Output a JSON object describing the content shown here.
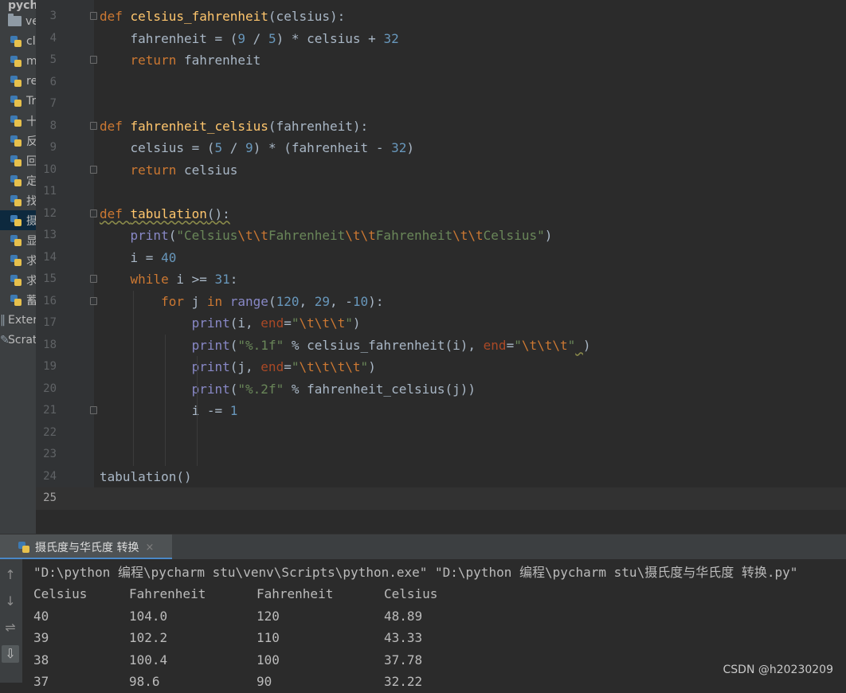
{
  "project_tree": {
    "root_label": "pych",
    "items": [
      {
        "label": "ve",
        "kind": "folder",
        "selected": false
      },
      {
        "label": "cl",
        "kind": "py",
        "selected": false
      },
      {
        "label": "m",
        "kind": "py",
        "selected": false
      },
      {
        "label": "re",
        "kind": "py",
        "selected": false
      },
      {
        "label": "Tr",
        "kind": "py",
        "selected": false
      },
      {
        "label": "十",
        "kind": "py",
        "selected": false
      },
      {
        "label": "反",
        "kind": "py",
        "selected": false
      },
      {
        "label": "回",
        "kind": "py",
        "selected": false
      },
      {
        "label": "定",
        "kind": "py",
        "selected": false
      },
      {
        "label": "找",
        "kind": "py",
        "selected": false
      },
      {
        "label": "摄",
        "kind": "py",
        "selected": true
      },
      {
        "label": "显",
        "kind": "py",
        "selected": false
      },
      {
        "label": "求",
        "kind": "py",
        "selected": false
      },
      {
        "label": "求",
        "kind": "py",
        "selected": false
      },
      {
        "label": "蓄",
        "kind": "py",
        "selected": false
      },
      {
        "label": "Exter",
        "kind": "lib",
        "selected": false
      },
      {
        "label": "Scrat",
        "kind": "scratch",
        "selected": false
      }
    ]
  },
  "editor": {
    "current_line": "25",
    "lines": [
      {
        "no": "3",
        "fold": true,
        "indent": 0,
        "code": [
          [
            "kw",
            "def "
          ],
          [
            "fn",
            "celsius_fahrenheit"
          ],
          [
            "t",
            "(celsius):"
          ]
        ]
      },
      {
        "no": "4",
        "fold": false,
        "indent": 1,
        "code": [
          [
            "t",
            "fahrenheit = ("
          ],
          [
            "num",
            "9"
          ],
          [
            "t",
            " / "
          ],
          [
            "num",
            "5"
          ],
          [
            "t",
            ") * celsius + "
          ],
          [
            "num",
            "32"
          ]
        ]
      },
      {
        "no": "5",
        "fold": true,
        "indent": 1,
        "code": [
          [
            "kw",
            "return "
          ],
          [
            "t",
            "fahrenheit"
          ]
        ]
      },
      {
        "no": "6",
        "fold": false,
        "indent": 0,
        "code": []
      },
      {
        "no": "7",
        "fold": false,
        "indent": 0,
        "code": []
      },
      {
        "no": "8",
        "fold": true,
        "indent": 0,
        "code": [
          [
            "kw",
            "def "
          ],
          [
            "fn",
            "fahrenheit_celsius"
          ],
          [
            "t",
            "(fahrenheit):"
          ]
        ]
      },
      {
        "no": "9",
        "fold": false,
        "indent": 1,
        "code": [
          [
            "t",
            "celsius = ("
          ],
          [
            "num",
            "5"
          ],
          [
            "t",
            " / "
          ],
          [
            "num",
            "9"
          ],
          [
            "t",
            ") * (fahrenheit - "
          ],
          [
            "num",
            "32"
          ],
          [
            "t",
            ")"
          ]
        ]
      },
      {
        "no": "10",
        "fold": true,
        "indent": 1,
        "code": [
          [
            "kw",
            "return "
          ],
          [
            "t",
            "celsius"
          ]
        ]
      },
      {
        "no": "11",
        "fold": false,
        "indent": 0,
        "code": []
      },
      {
        "no": "12",
        "fold": true,
        "indent": 0,
        "code": [
          [
            "kwwavy",
            "def "
          ],
          [
            "fnwavy",
            "tabulation"
          ],
          [
            "twavy",
            "():"
          ]
        ]
      },
      {
        "no": "13",
        "fold": false,
        "indent": 1,
        "code": [
          [
            "bi",
            "print"
          ],
          [
            "t",
            "("
          ],
          [
            "str",
            "\"Celsius"
          ],
          [
            "esc",
            "\\t\\t"
          ],
          [
            "str",
            "Fahrenheit"
          ],
          [
            "esc",
            "\\t\\t"
          ],
          [
            "str",
            "Fahrenheit"
          ],
          [
            "esc",
            "\\t\\t"
          ],
          [
            "str",
            "Celsius\""
          ],
          [
            "t",
            ")"
          ]
        ]
      },
      {
        "no": "14",
        "fold": false,
        "indent": 1,
        "code": [
          [
            "t",
            "i = "
          ],
          [
            "num",
            "40"
          ]
        ]
      },
      {
        "no": "15",
        "fold": true,
        "indent": 1,
        "code": [
          [
            "kw",
            "while "
          ],
          [
            "t",
            "i >= "
          ],
          [
            "num",
            "31"
          ],
          [
            "t",
            ":"
          ]
        ]
      },
      {
        "no": "16",
        "fold": true,
        "indent": 2,
        "code": [
          [
            "kw",
            "for "
          ],
          [
            "t",
            "j "
          ],
          [
            "kw",
            "in "
          ],
          [
            "bi",
            "range"
          ],
          [
            "t",
            "("
          ],
          [
            "num",
            "120"
          ],
          [
            "t",
            ", "
          ],
          [
            "num",
            "29"
          ],
          [
            "t",
            ", -"
          ],
          [
            "num",
            "10"
          ],
          [
            "t",
            "):"
          ]
        ]
      },
      {
        "no": "17",
        "fold": false,
        "indent": 3,
        "code": [
          [
            "bi",
            "print"
          ],
          [
            "t",
            "(i, "
          ],
          [
            "prm",
            "end"
          ],
          [
            "t",
            "="
          ],
          [
            "str",
            "\""
          ],
          [
            "esc",
            "\\t\\t\\t"
          ],
          [
            "str",
            "\""
          ],
          [
            "t",
            ")"
          ]
        ]
      },
      {
        "no": "18",
        "fold": false,
        "indent": 3,
        "code": [
          [
            "bi",
            "print"
          ],
          [
            "t",
            "("
          ],
          [
            "str",
            "\"%.1f\""
          ],
          [
            "t",
            " % celsius_fahrenheit(i), "
          ],
          [
            "prm",
            "end"
          ],
          [
            "t",
            "="
          ],
          [
            "str",
            "\""
          ],
          [
            "esc",
            "\\t\\t\\t"
          ],
          [
            "str",
            "\""
          ],
          [
            "twavy",
            " "
          ],
          [
            "t",
            ")"
          ]
        ]
      },
      {
        "no": "19",
        "fold": false,
        "indent": 3,
        "code": [
          [
            "bi",
            "print"
          ],
          [
            "t",
            "(j, "
          ],
          [
            "prm",
            "end"
          ],
          [
            "t",
            "="
          ],
          [
            "str",
            "\""
          ],
          [
            "esc",
            "\\t\\t\\t\\t"
          ],
          [
            "str",
            "\""
          ],
          [
            "t",
            ")"
          ]
        ]
      },
      {
        "no": "20",
        "fold": false,
        "indent": 3,
        "code": [
          [
            "bi",
            "print"
          ],
          [
            "t",
            "("
          ],
          [
            "str",
            "\"%.2f\""
          ],
          [
            "t",
            " % fahrenheit_celsius(j))"
          ]
        ]
      },
      {
        "no": "21",
        "fold": true,
        "indent": 3,
        "code": [
          [
            "t",
            "i -= "
          ],
          [
            "num",
            "1"
          ]
        ]
      },
      {
        "no": "22",
        "fold": false,
        "indent": 0,
        "code": []
      },
      {
        "no": "23",
        "fold": false,
        "indent": 0,
        "code": []
      },
      {
        "no": "24",
        "fold": false,
        "indent": 0,
        "code": [
          [
            "t",
            "tabulation()"
          ]
        ]
      },
      {
        "no": "25",
        "fold": false,
        "indent": 0,
        "code": []
      }
    ]
  },
  "run_panel": {
    "tab_label": "摄氏度与华氏度 转换",
    "close_glyph": "×",
    "tools": [
      "↑",
      "↓",
      "⇌",
      "⇩"
    ],
    "command": "\"D:\\python 编程\\pycharm stu\\venv\\Scripts\\python.exe\" \"D:\\python 编程\\pycharm stu\\摄氏度与华氏度 转换.py\"",
    "output_rows": [
      [
        "Celsius",
        "Fahrenheit",
        "Fahrenheit",
        "Celsius"
      ],
      [
        "40",
        "104.0",
        "120",
        "48.89"
      ],
      [
        "39",
        "102.2",
        "110",
        "43.33"
      ],
      [
        "38",
        "100.4",
        "100",
        "37.78"
      ],
      [
        "37",
        "98.6",
        "90",
        "32.22"
      ]
    ]
  },
  "watermark": "CSDN @h20230209",
  "colors": {
    "editor_bg": "#2b2b2b",
    "keyword": "#cc7832",
    "function": "#ffc66d",
    "number": "#6897bb",
    "string": "#6a8759",
    "builtin": "#8888c6",
    "param": "#aa4926",
    "tab_accent": "#4a88c7"
  }
}
